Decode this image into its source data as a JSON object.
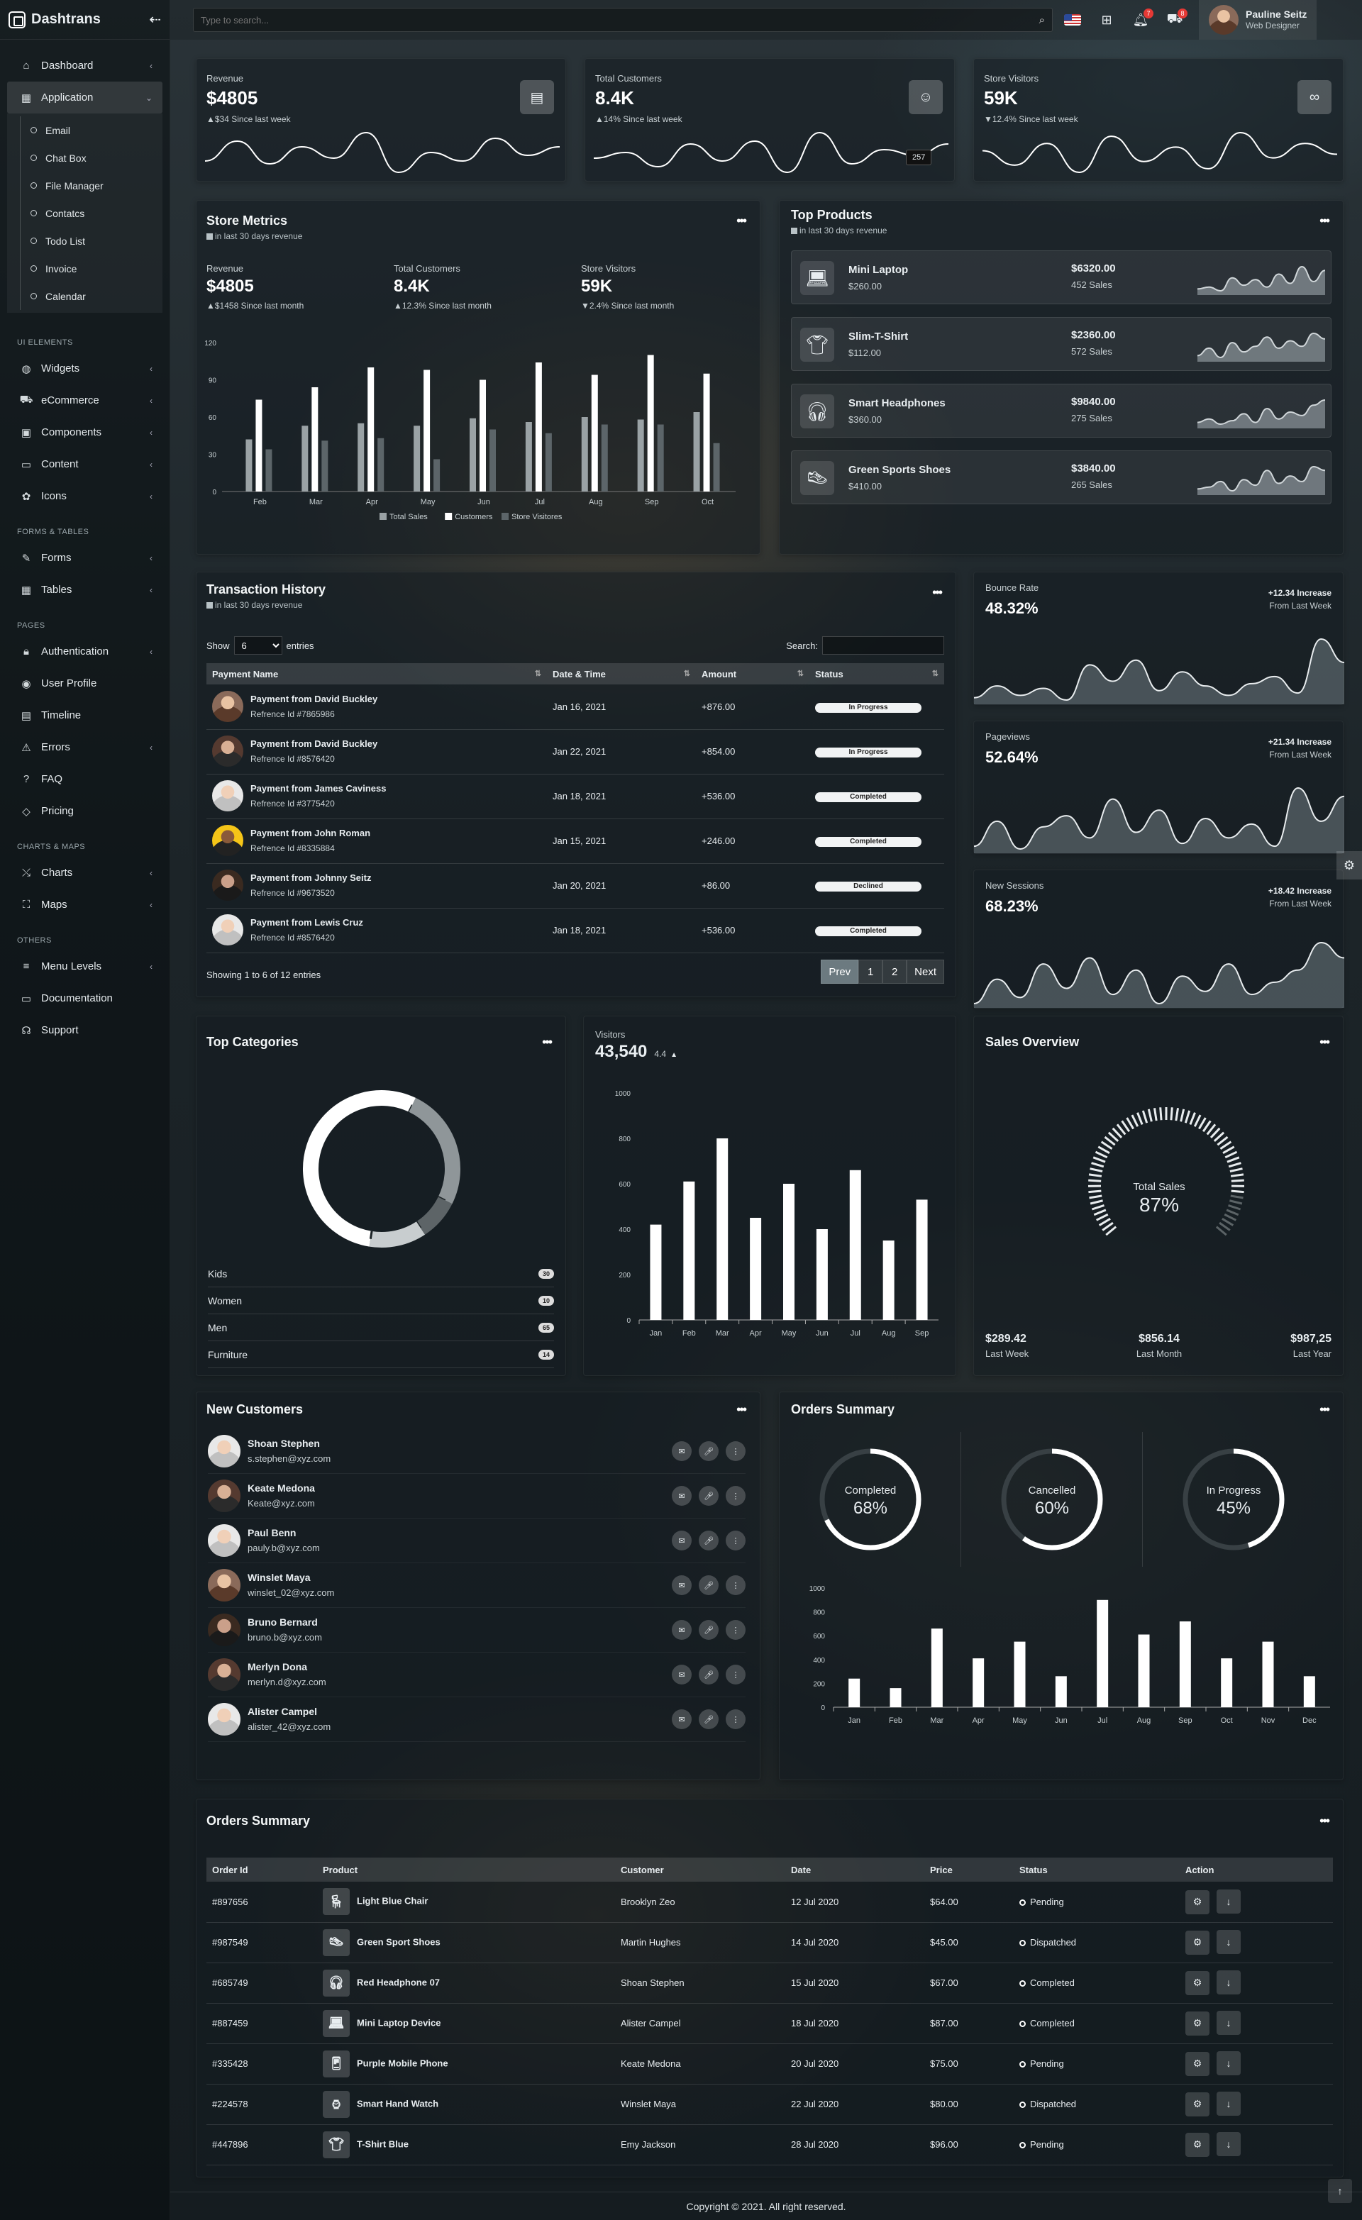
{
  "app": {
    "title": "Dashtrans"
  },
  "sidebar": {
    "top": [
      {
        "label": "Dashboard"
      },
      {
        "label": "Application"
      }
    ],
    "app_sub": [
      "Email",
      "Chat Box",
      "File Manager",
      "Contatcs",
      "Todo List",
      "Invoice",
      "Calendar"
    ],
    "sections": [
      {
        "caption": "UI ELEMENTS",
        "items": [
          "Widgets",
          "eCommerce",
          "Components",
          "Content",
          "Icons"
        ]
      },
      {
        "caption": "FORMS & TABLES",
        "items": [
          "Forms",
          "Tables"
        ]
      },
      {
        "caption": "PAGES",
        "items": [
          "Authentication",
          "User Profile",
          "Timeline",
          "Errors",
          "FAQ",
          "Pricing"
        ]
      },
      {
        "caption": "CHARTS & MAPS",
        "items": [
          "Charts",
          "Maps"
        ]
      },
      {
        "caption": "OTHERS",
        "items": [
          "Menu Levels",
          "Documentation",
          "Support"
        ]
      }
    ]
  },
  "topbar": {
    "search_placeholder": "Type to search...",
    "notif_count": "7",
    "msg_count": "8",
    "user": {
      "name": "Pauline Seitz",
      "role": "Web Designer"
    }
  },
  "kpis": [
    {
      "label": "Revenue",
      "value": "$4805",
      "delta": "▲$34 Since last week",
      "icon": "wallet-icon"
    },
    {
      "label": "Total Customers",
      "value": "8.4K",
      "delta": "▲14% Since last week",
      "icon": "users-icon",
      "tooltip": "257"
    },
    {
      "label": "Store Visitors",
      "value": "59K",
      "delta": "▼12.4% Since last week",
      "icon": "binoculars-icon"
    }
  ],
  "store_metrics": {
    "title": "Store Metrics",
    "subtitle": "in last 30 days revenue",
    "stats": [
      {
        "label": "Revenue",
        "value": "$4805",
        "delta": "▲$1458 Since last month"
      },
      {
        "label": "Total Customers",
        "value": "8.4K",
        "delta": "▲12.3% Since last month"
      },
      {
        "label": "Store Visitors",
        "value": "59K",
        "delta": "▼2.4% Since last month"
      }
    ]
  },
  "top_products": {
    "title": "Top Products",
    "subtitle": "in last 30 days revenue",
    "items": [
      {
        "name": "Mini Laptop",
        "price": "$260.00",
        "revenue": "$6320.00",
        "sales": "452 Sales",
        "icon": "laptop-icon"
      },
      {
        "name": "Slim-T-Shirt",
        "price": "$112.00",
        "revenue": "$2360.00",
        "sales": "572 Sales",
        "icon": "tshirt-icon"
      },
      {
        "name": "Smart Headphones",
        "price": "$360.00",
        "revenue": "$9840.00",
        "sales": "275 Sales",
        "icon": "headphones-icon"
      },
      {
        "name": "Green Sports Shoes",
        "price": "$410.00",
        "revenue": "$3840.00",
        "sales": "265 Sales",
        "icon": "shoe-icon"
      }
    ]
  },
  "transactions": {
    "title": "Transaction History",
    "subtitle": "in last 30 days revenue",
    "show_label": "Show",
    "entries_label": "entries",
    "entries_value": "6",
    "search_label": "Search:",
    "headers": [
      "Payment Name",
      "Date & Time",
      "Amount",
      "Status"
    ],
    "rows": [
      {
        "name": "Payment from David Buckley",
        "ref": "Refrence Id #7865986",
        "date": "Jan 16, 2021",
        "amount": "+876.00",
        "status": "In Progress"
      },
      {
        "name": "Payment from David Buckley",
        "ref": "Refrence Id #8576420",
        "date": "Jan 22, 2021",
        "amount": "+854.00",
        "status": "In Progress"
      },
      {
        "name": "Payment from James Caviness",
        "ref": "Refrence Id #3775420",
        "date": "Jan 18, 2021",
        "amount": "+536.00",
        "status": "Completed"
      },
      {
        "name": "Payment from John Roman",
        "ref": "Refrence Id #8335884",
        "date": "Jan 15, 2021",
        "amount": "+246.00",
        "status": "Completed"
      },
      {
        "name": "Payment from Johnny Seitz",
        "ref": "Refrence Id #9673520",
        "date": "Jan 20, 2021",
        "amount": "+86.00",
        "status": "Declined"
      },
      {
        "name": "Payment from Lewis Cruz",
        "ref": "Refrence Id #8576420",
        "date": "Jan 18, 2021",
        "amount": "+536.00",
        "status": "Completed"
      }
    ],
    "info": "Showing 1 to 6 of 12 entries",
    "pagination": {
      "prev": "Prev",
      "pages": [
        "1",
        "2"
      ],
      "next": "Next"
    }
  },
  "rate_cards": [
    {
      "label": "Bounce Rate",
      "value": "48.32%",
      "delta": "+12.34 Increase",
      "period": "From Last Week"
    },
    {
      "label": "Pageviews",
      "value": "52.64%",
      "delta": "+21.34 Increase",
      "period": "From Last Week"
    },
    {
      "label": "New Sessions",
      "value": "68.23%",
      "delta": "+18.42 Increase",
      "period": "From Last Week"
    }
  ],
  "top_categories": {
    "title": "Top Categories",
    "items": [
      {
        "name": "Kids",
        "count": "30"
      },
      {
        "name": "Women",
        "count": "10"
      },
      {
        "name": "Men",
        "count": "65"
      },
      {
        "name": "Furniture",
        "count": "14"
      }
    ]
  },
  "visitors": {
    "label": "Visitors",
    "value": "43,540",
    "delta": "4.4"
  },
  "sales_overview": {
    "title": "Sales Overview",
    "gauge_label": "Total Sales",
    "gauge_value": "87%",
    "stats": [
      {
        "value": "$289.42",
        "label": "Last Week"
      },
      {
        "value": "$856.14",
        "label": "Last Month"
      },
      {
        "value": "$987,25",
        "label": "Last Year"
      }
    ]
  },
  "new_customers": {
    "title": "New Customers",
    "items": [
      {
        "name": "Shoan Stephen",
        "email": "s.stephen@xyz.com"
      },
      {
        "name": "Keate Medona",
        "email": "Keate@xyz.com"
      },
      {
        "name": "Paul Benn",
        "email": "pauly.b@xyz.com"
      },
      {
        "name": "Winslet Maya",
        "email": "winslet_02@xyz.com"
      },
      {
        "name": "Bruno Bernard",
        "email": "bruno.b@xyz.com"
      },
      {
        "name": "Merlyn Dona",
        "email": "merlyn.d@xyz.com"
      },
      {
        "name": "Alister Campel",
        "email": "alister_42@xyz.com"
      }
    ]
  },
  "orders_donuts": {
    "title": "Orders Summary",
    "items": [
      {
        "label": "Completed",
        "value": "68%",
        "pct": 68
      },
      {
        "label": "Cancelled",
        "value": "60%",
        "pct": 60
      },
      {
        "label": "In Progress",
        "value": "45%",
        "pct": 45
      }
    ]
  },
  "orders_table": {
    "title": "Orders Summary",
    "headers": [
      "Order Id",
      "Product",
      "Customer",
      "Date",
      "Price",
      "Status",
      "Action"
    ],
    "rows": [
      {
        "id": "#897656",
        "product": "Light Blue Chair",
        "customer": "Brooklyn Zeo",
        "date": "12 Jul 2020",
        "price": "$64.00",
        "status": "Pending",
        "icon": "chair-icon"
      },
      {
        "id": "#987549",
        "product": "Green Sport Shoes",
        "customer": "Martin Hughes",
        "date": "14 Jul 2020",
        "price": "$45.00",
        "status": "Dispatched",
        "icon": "shoe-icon"
      },
      {
        "id": "#685749",
        "product": "Red Headphone 07",
        "customer": "Shoan Stephen",
        "date": "15 Jul 2020",
        "price": "$67.00",
        "status": "Completed",
        "icon": "headphones-icon"
      },
      {
        "id": "#887459",
        "product": "Mini Laptop Device",
        "customer": "Alister Campel",
        "date": "18 Jul 2020",
        "price": "$87.00",
        "status": "Completed",
        "icon": "laptop-icon"
      },
      {
        "id": "#335428",
        "product": "Purple Mobile Phone",
        "customer": "Keate Medona",
        "date": "20 Jul 2020",
        "price": "$75.00",
        "status": "Pending",
        "icon": "phone-icon"
      },
      {
        "id": "#224578",
        "product": "Smart Hand Watch",
        "customer": "Winslet Maya",
        "date": "22 Jul 2020",
        "price": "$80.00",
        "status": "Dispatched",
        "icon": "watch-icon"
      },
      {
        "id": "#447896",
        "product": "T-Shirt Blue",
        "customer": "Emy Jackson",
        "date": "28 Jul 2020",
        "price": "$96.00",
        "status": "Pending",
        "icon": "tshirt-icon"
      }
    ]
  },
  "footer": {
    "text": "Copyright © 2021. All right reserved."
  },
  "chart_data": [
    {
      "type": "bar",
      "categories": [
        "Feb",
        "Mar",
        "Apr",
        "May",
        "Jun",
        "Jul",
        "Aug",
        "Sep",
        "Oct"
      ],
      "series": [
        {
          "name": "Total Sales",
          "values": [
            42,
            53,
            55,
            53,
            59,
            56,
            60,
            58,
            64
          ]
        },
        {
          "name": "Customers",
          "values": [
            74,
            84,
            100,
            98,
            90,
            104,
            94,
            110,
            95
          ]
        },
        {
          "name": "Store Visitores",
          "values": [
            34,
            41,
            43,
            26,
            50,
            47,
            54,
            54,
            39
          ]
        }
      ],
      "ylim": [
        0,
        120
      ],
      "yticks": [
        0,
        30,
        60,
        90,
        120
      ],
      "legend": "bottom"
    },
    {
      "type": "bar",
      "categories": [
        "Jan",
        "Feb",
        "Mar",
        "Apr",
        "May",
        "Jun",
        "Jul",
        "Aug",
        "Sep"
      ],
      "values": [
        420,
        610,
        800,
        450,
        600,
        400,
        660,
        350,
        530
      ],
      "ylim": [
        0,
        1000
      ],
      "yticks": [
        0,
        200,
        400,
        600,
        800,
        1000
      ]
    },
    {
      "type": "bar",
      "categories": [
        "Jan",
        "Feb",
        "Mar",
        "Apr",
        "May",
        "Jun",
        "Jul",
        "Aug",
        "Sep",
        "Oct",
        "Nov",
        "Dec"
      ],
      "values": [
        240,
        160,
        660,
        410,
        550,
        260,
        900,
        610,
        720,
        410,
        550,
        260
      ],
      "ylim": [
        0,
        1000
      ],
      "yticks": [
        0,
        200,
        400,
        600,
        800,
        1000
      ]
    },
    {
      "type": "pie",
      "categories": [
        "Kids",
        "Women",
        "Men",
        "Furniture"
      ],
      "values": [
        30,
        10,
        65,
        14
      ]
    },
    {
      "type": "area",
      "title": "",
      "series": [
        {
          "name": "Bounce Rate",
          "values": [
            30,
            40,
            32,
            38,
            28,
            58,
            44,
            62,
            36,
            52,
            40,
            32,
            42,
            48,
            34,
            80,
            60
          ]
        },
        {
          "name": "Pageviews",
          "values": [
            30,
            48,
            28,
            44,
            52,
            36,
            64,
            40,
            56,
            32,
            50,
            36,
            46,
            30,
            72,
            48,
            66
          ]
        },
        {
          "name": "New Sessions",
          "values": [
            30,
            46,
            34,
            56,
            40,
            60,
            36,
            52,
            30,
            48,
            38,
            56,
            36,
            44,
            52,
            70,
            60
          ]
        }
      ]
    }
  ]
}
